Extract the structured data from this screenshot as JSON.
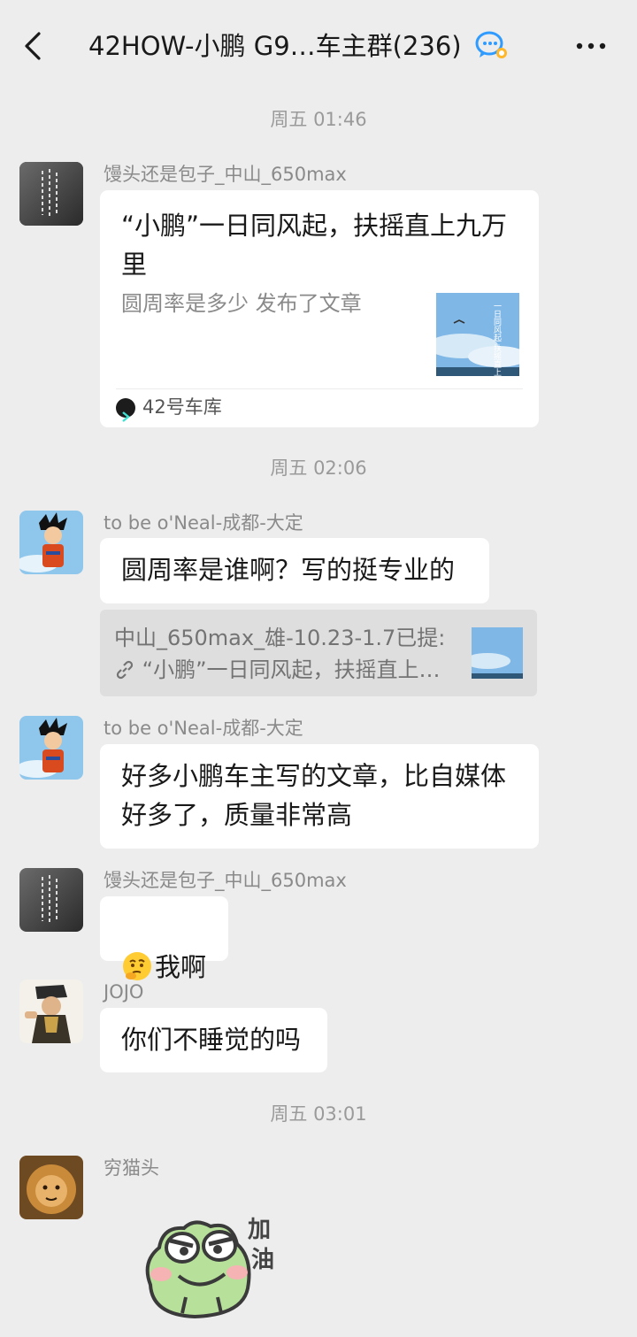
{
  "header": {
    "title": "42HOW-小鹏 G9…车主群(236)",
    "back_icon": "chevron-left-icon",
    "group_icon": "wechat-group-chat-icon",
    "more_icon": "more-dots-icon"
  },
  "messages": {
    "t1": "周五 01:46",
    "m1": {
      "sender": "馒头还是包子_中山_650max",
      "card_title": "“小鹏”一日同风起，扶摇直上九万里",
      "card_desc": "圆周率是多少 发布了文章",
      "card_source": "42号车库",
      "thumb_text": "一日同风起 扶摇直上九万里"
    },
    "t2": "周五 02:06",
    "m2": {
      "sender": "to be o'Neal-成都-大定",
      "text": "圆周率是谁啊？写的挺专业的",
      "quote_line1": "中山_650max_雄-10.23-1.7已提:",
      "quote_line2": "“小鹏”一日同风起，扶摇直上…"
    },
    "m3": {
      "sender": "to be o'Neal-成都-大定",
      "text": "好多小鹏车主写的文章，比自媒体\n好多了，质量非常高"
    },
    "m4": {
      "sender": "馒头还是包子_中山_650max",
      "text": "我啊",
      "emoji": "thinking-face-icon"
    },
    "m5": {
      "sender": "JOJO",
      "text": "你们不睡觉的吗"
    },
    "t3": "周五 03:01",
    "m6": {
      "sender": "穷猫头",
      "sticker_text_1": "加",
      "sticker_text_2": "油",
      "sticker": "frog-cheer-sticker"
    }
  },
  "colors": {
    "background": "#ededed",
    "bubble": "#ffffff",
    "meta_text": "#9a9a9a",
    "accent": "#2f9bff"
  }
}
